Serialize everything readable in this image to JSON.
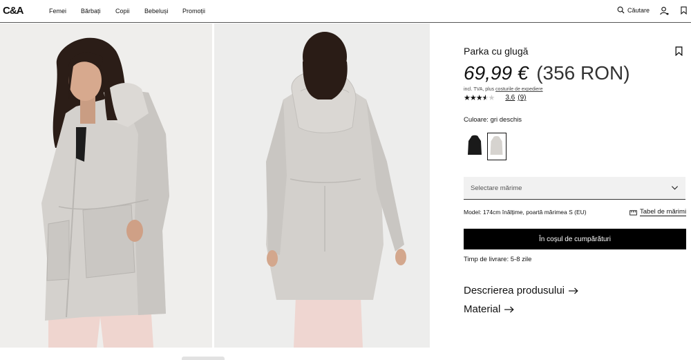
{
  "header": {
    "logo": "C&A",
    "nav": [
      "Femei",
      "Bărbați",
      "Copii",
      "Bebeluși",
      "Promoții"
    ],
    "search_label": "Căutare"
  },
  "product": {
    "title": "Parka cu glugă",
    "price_eur": "69,99 €",
    "price_ron": "(356 RON)",
    "vat_prefix": "incl. TVA, plus ",
    "vat_link": "costurile de expediere",
    "rating_value": "3.6",
    "rating_count": "(9)",
    "rating_stars": 3.6,
    "color_label": "Culoare:",
    "color_value": "gri deschis",
    "size_placeholder": "Selectare mărime",
    "model_info": "Model: 174cm înălțime, poartă mărimea S (EU)",
    "size_table_label": "Tabel de mărimi",
    "cart_button": "În coșul de cumpărături",
    "delivery": "Timp de livrare: 5-8 zile",
    "description_link": "Descrierea produsului",
    "material_link": "Material"
  },
  "colors": {
    "accent": "#000000",
    "coat": "#d3d0cc",
    "pants": "#efd6d1"
  },
  "icons": [
    "search-icon",
    "user-icon",
    "bookmark-icon",
    "chevron-down-icon",
    "ruler-icon",
    "arrow-right-icon"
  ]
}
